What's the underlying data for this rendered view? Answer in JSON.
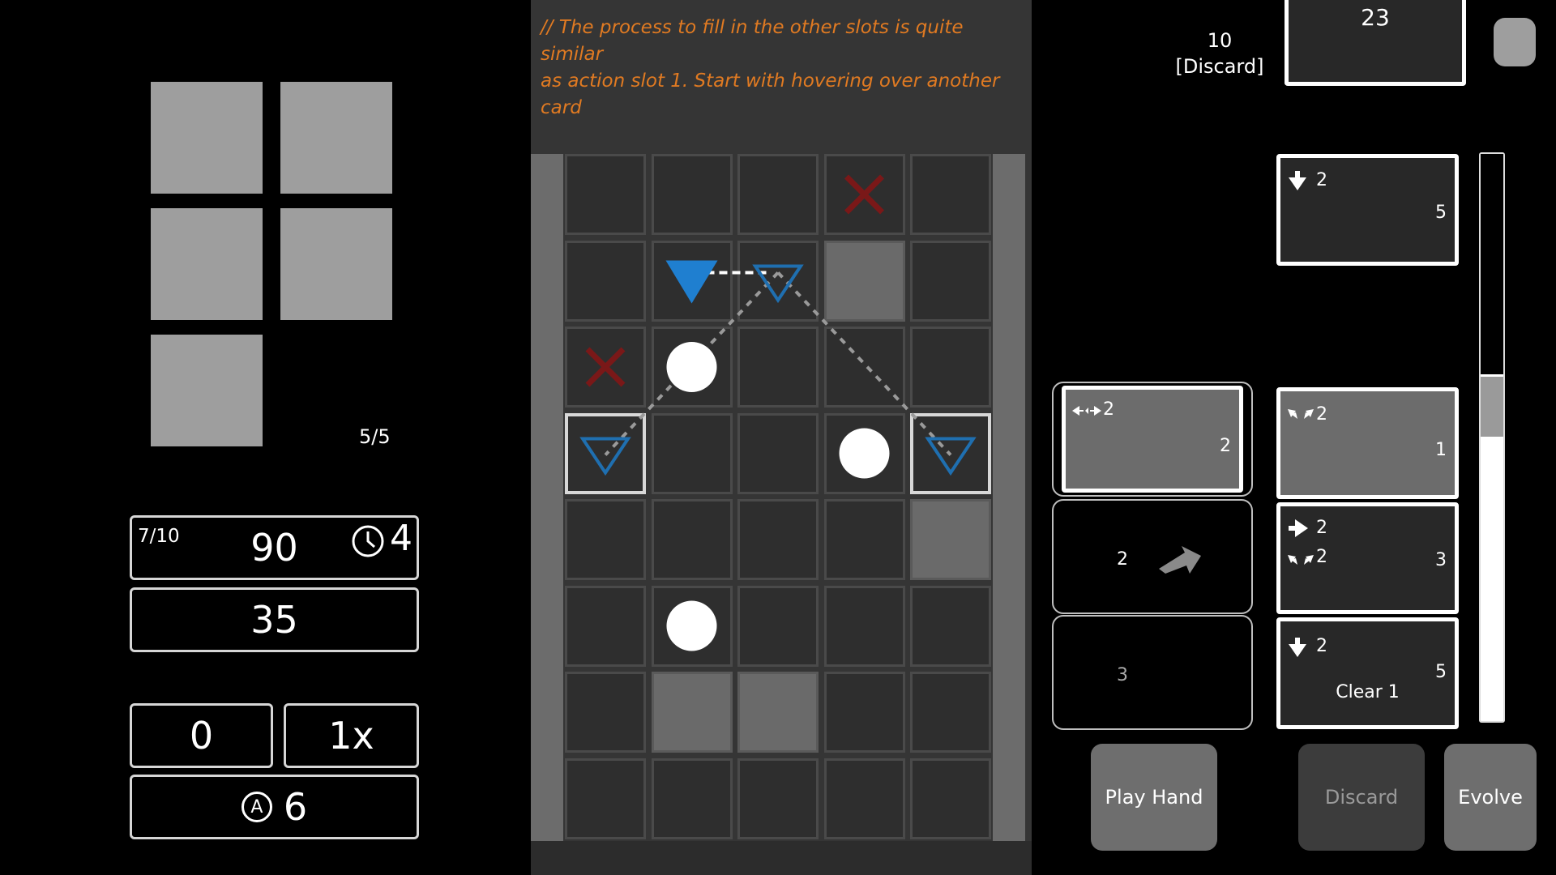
{
  "hint": {
    "line1": "// The process to fill in the other slots is quite similar",
    "line2": "as action slot 1. Start with hovering over another card"
  },
  "inventory": {
    "slot_count_label": "5/5"
  },
  "stats": {
    "moves": "7/10",
    "score": "90",
    "timer_icon": "clock-icon",
    "timer_value": "4",
    "target": "35",
    "left_value": "0",
    "multiplier": "1x",
    "a_icon_letter": "A",
    "a_value": "6"
  },
  "deck": {
    "discard_count": "10",
    "discard_label": "[Discard]",
    "deck_count": "23"
  },
  "hand_slots": [
    {
      "move_icon": "arrows-horizontal-icon",
      "move_value": "2",
      "cost": "2"
    },
    {
      "value": "2",
      "arrow_icon": "arrow-right-icon"
    },
    {
      "value": "3"
    }
  ],
  "cards": [
    {
      "row1_icon": "arrow-down-icon",
      "row1_value": "2",
      "cost": "5",
      "extra": ""
    },
    {
      "row1_icon": "arrows-diagonal-icon",
      "row1_value": "2",
      "cost": "1",
      "extra": ""
    },
    {
      "row1_icon": "arrow-right-icon",
      "row1_value": "2",
      "row2_icon": "arrows-diagonal-icon",
      "row2_value": "2",
      "cost": "3",
      "extra": ""
    },
    {
      "row1_icon": "arrow-down-icon",
      "row1_value": "2",
      "cost": "5",
      "extra": "Clear 1"
    }
  ],
  "buttons": {
    "play_hand": "Play Hand",
    "discard": "Discard",
    "evolve": "Evolve"
  },
  "board": {
    "rows": 8,
    "cols": 5,
    "light_cells": [
      "1-3",
      "4-4",
      "6-1",
      "6-2"
    ],
    "blocked_cells": [
      "0-3",
      "2-0"
    ],
    "orb_cells": [
      "2-1",
      "3-3",
      "5-1"
    ],
    "target_cells": [
      "1-2",
      "3-0",
      "3-4"
    ],
    "player_cell": "1-1",
    "highlight_cells": [
      "3-0",
      "3-4"
    ],
    "colors": {
      "player": "#1f7fd0",
      "target": "#1f6fb0",
      "blocked": "#7a1818",
      "hint": "#e07a22"
    }
  }
}
